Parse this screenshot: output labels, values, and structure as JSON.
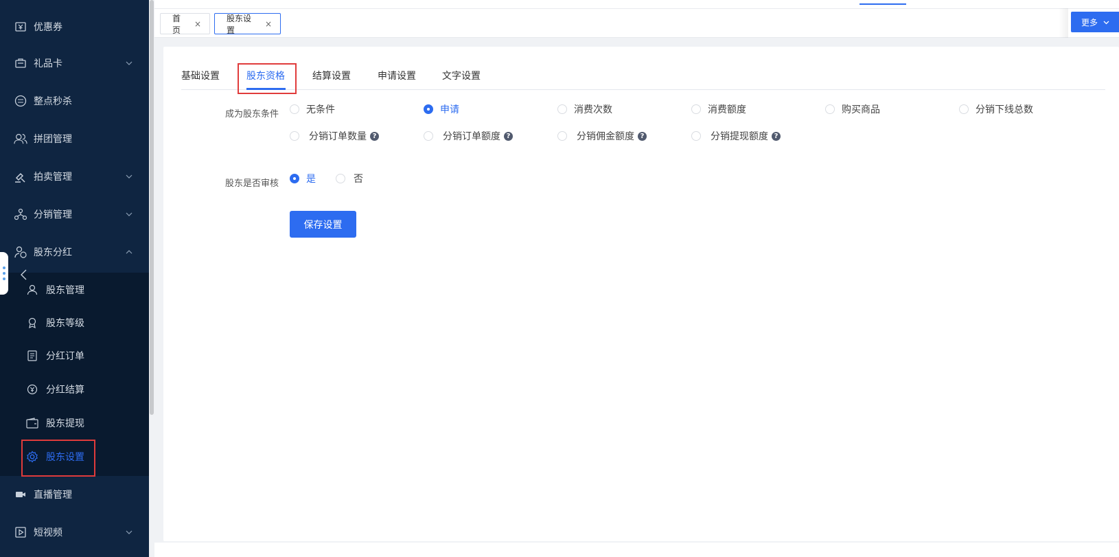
{
  "sidebar": {
    "items": [
      {
        "label": "优惠券",
        "icon": "ticket-icon"
      },
      {
        "label": "礼品卡",
        "icon": "gift-card-icon"
      },
      {
        "label": "整点秒杀",
        "icon": "flash-sale-icon"
      },
      {
        "label": "拼团管理",
        "icon": "group-users-icon"
      },
      {
        "label": "拍卖管理",
        "icon": "gavel-icon"
      },
      {
        "label": "分销管理",
        "icon": "network-icon"
      },
      {
        "label": "股东分红",
        "icon": "shareholder-icon"
      }
    ],
    "submenu": [
      {
        "label": "股东管理",
        "icon": "user-icon"
      },
      {
        "label": "股东等级",
        "icon": "medal-icon"
      },
      {
        "label": "分红订单",
        "icon": "document-icon"
      },
      {
        "label": "分红结算",
        "icon": "coin-icon"
      },
      {
        "label": "股东提现",
        "icon": "wallet-icon"
      },
      {
        "label": "股东设置",
        "icon": "gear-icon"
      }
    ],
    "bottom_items": [
      {
        "label": "直播管理",
        "icon": "video-camera-icon"
      },
      {
        "label": "短视频",
        "icon": "play-icon"
      }
    ],
    "colors": {
      "bg": "#0f2541",
      "active": "#2d6cf0",
      "highlight": "#e03b3b"
    }
  },
  "tabs": {
    "items": [
      {
        "label": "首页",
        "close": "×"
      },
      {
        "label": "股东设置",
        "close": "×"
      }
    ],
    "more_label": "更多"
  },
  "subtabs": [
    "基础设置",
    "股东资格",
    "结算设置",
    "申请设置",
    "文字设置"
  ],
  "form": {
    "condition_label": "成为股东条件",
    "conditions_row1": [
      "无条件",
      "申请",
      "消费次数",
      "消费额度",
      "购买商品",
      "分销下线总数"
    ],
    "conditions_row2": [
      "分销订单数量",
      "分销订单额度",
      "分销佣金额度",
      "分销提现额度"
    ],
    "selected_condition": "申请",
    "audit_label": "股东是否审核",
    "audit_yes": "是",
    "audit_no": "否",
    "selected_audit": "是",
    "help_glyph": "?"
  },
  "save_label": "保存设置"
}
